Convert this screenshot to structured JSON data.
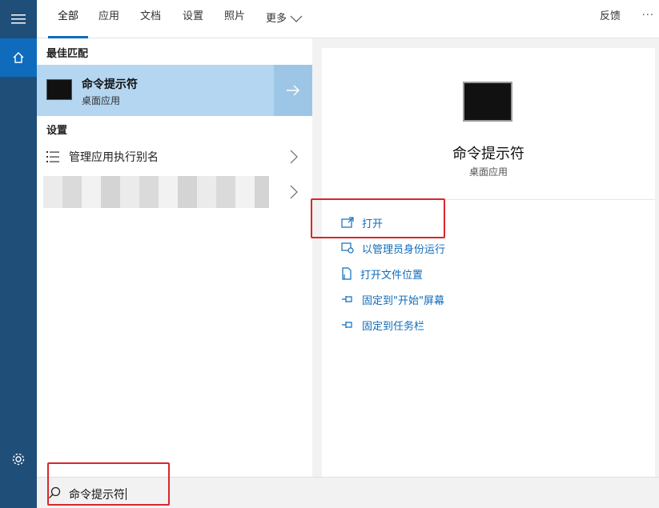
{
  "tabs": [
    {
      "label": "全部",
      "active": true
    },
    {
      "label": "应用"
    },
    {
      "label": "文档"
    },
    {
      "label": "设置"
    },
    {
      "label": "照片"
    },
    {
      "label": "更多"
    }
  ],
  "feedback_label": "反馈",
  "more_dots": "···",
  "results": {
    "best_match_title": "最佳匹配",
    "best_match": {
      "title": "命令提示符",
      "subtitle": "桌面应用"
    },
    "settings_title": "设置",
    "settings_items": [
      {
        "label": "管理应用执行别名"
      }
    ]
  },
  "detail": {
    "title": "命令提示符",
    "subtitle": "桌面应用",
    "actions": [
      {
        "label": "打开",
        "icon": "open-window-icon"
      },
      {
        "label": "以管理员身份运行",
        "icon": "admin-shield-icon"
      },
      {
        "label": "打开文件位置",
        "icon": "file-location-icon"
      },
      {
        "label": "固定到\"开始\"屏幕",
        "icon": "pin-icon"
      },
      {
        "label": "固定到任务栏",
        "icon": "pin-icon"
      }
    ]
  },
  "search": {
    "value": "命令提示符"
  },
  "colors": {
    "rail": "#1f4e79",
    "accent": "#0f6cbd",
    "selected": "#b4d6f1",
    "highlight": "#d9262b"
  }
}
